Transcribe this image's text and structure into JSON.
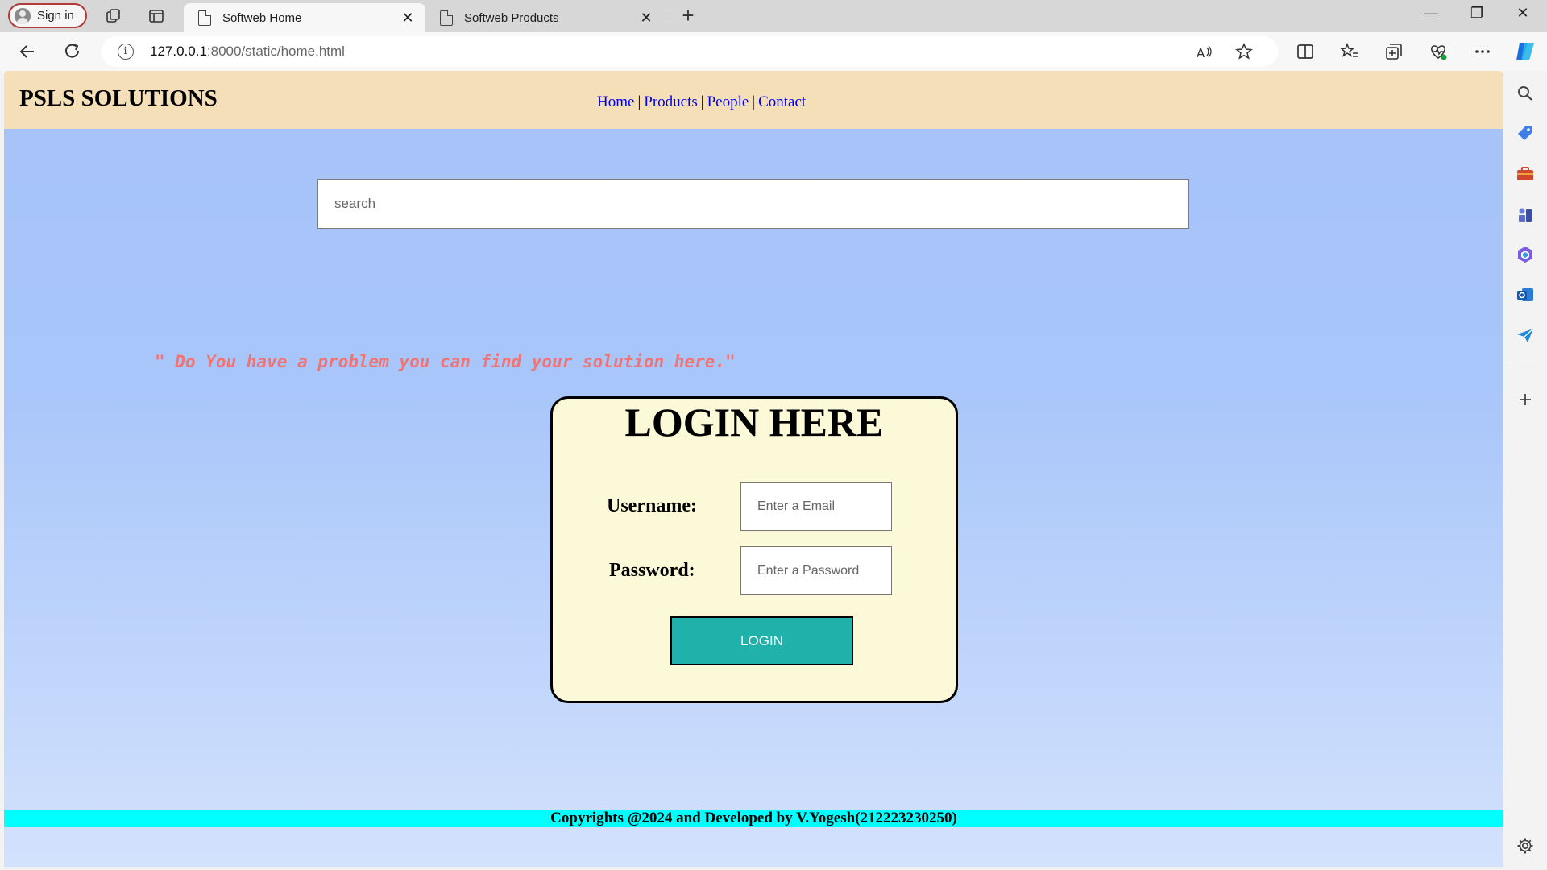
{
  "browser": {
    "signin_label": "Sign in",
    "tabs": [
      {
        "title": "Softweb Home",
        "active": true
      },
      {
        "title": "Softweb Products",
        "active": false
      }
    ],
    "close_glyph": "✕",
    "new_tab_glyph": "+",
    "url_host": "127.0.0.1",
    "url_path": ":8000/static/home.html",
    "info_glyph": "i",
    "window_controls": {
      "minimize": "—",
      "restore": "❐",
      "close": "✕"
    }
  },
  "site": {
    "brand": "PSLS SOLUTIONS",
    "nav": [
      "Home",
      "Products",
      "People",
      "Contact"
    ],
    "nav_separator": "|",
    "search_placeholder": "search",
    "tagline": "\" Do You have a problem you can find your solution here.\"",
    "login": {
      "title": "LOGIN HERE",
      "username_label": "Username:",
      "username_placeholder": "Enter a Email",
      "password_label": "Password:",
      "password_placeholder": "Enter a Password",
      "button_label": "LOGIN"
    },
    "footer": "Copyrights @2024 and Developed by V.Yogesh(212223230250)"
  },
  "colors": {
    "header_bg": "#f5dfb8",
    "page_bg": "#a6c2f8",
    "tagline": "#f07474",
    "card_bg": "#fbf9d7",
    "login_button": "#20b2aa",
    "footer_bg": "#00ffff"
  }
}
